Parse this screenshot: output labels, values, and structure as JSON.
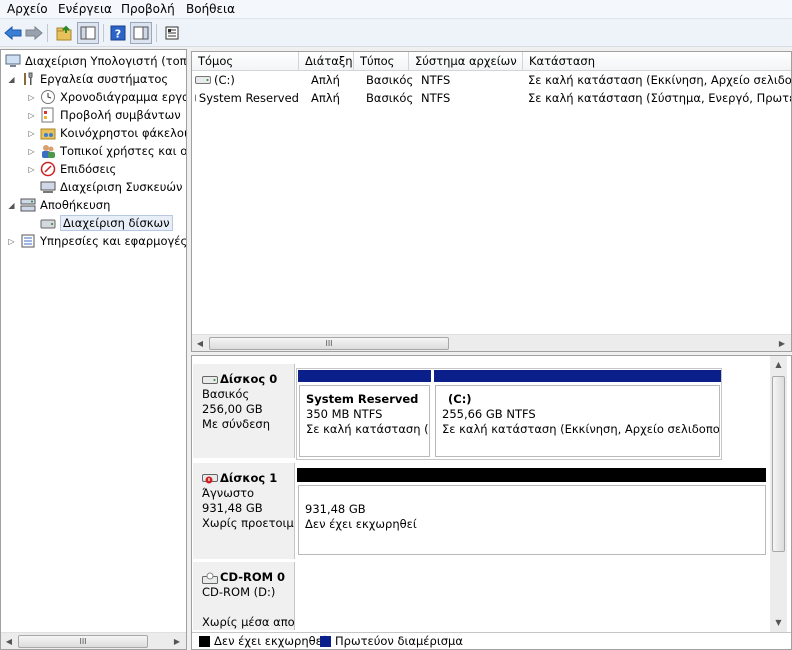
{
  "menu": [
    "Αρχείο",
    "Ενέργεια",
    "Προβολή",
    "Βοήθεια"
  ],
  "tree": {
    "root": "Διαχείριση Υπολογιστή (τοπικός)",
    "system_tools": "Εργαλεία συστήματος",
    "task_scheduler": "Χρονοδιάγραμμα εργασιών",
    "event_viewer": "Προβολή συμβάντων",
    "shared_folders": "Κοινόχρηστοι φάκελοι",
    "local_users": "Τοπικοί χρήστες και ομάδες",
    "performance": "Επιδόσεις",
    "device_manager": "Διαχείριση Συσκευών",
    "storage": "Αποθήκευση",
    "disk_management": "Διαχείριση δίσκων",
    "services": "Υπηρεσίες και εφαρμογές"
  },
  "list": {
    "headers": [
      "Τόμος",
      "Διάταξη",
      "Τύπος",
      "Σύστημα αρχείων",
      "Κατάσταση"
    ],
    "rows": [
      {
        "volume": "(C:)",
        "layout": "Απλή",
        "type": "Βασικός",
        "fs": "NTFS",
        "status": "Σε καλή κατάσταση (Εκκίνηση, Αρχείο σελιδοποίησης, Ενδεία σφαλμάτων, Πρωτεύον διαμέρισμα)"
      },
      {
        "volume": "System Reserved",
        "layout": "Απλή",
        "type": "Βασικός",
        "fs": "NTFS",
        "status": "Σε καλή κατάσταση (Σύστημα, Ενεργό, Πρωτεύον διαμέρισμα)"
      }
    ],
    "scroll_grip": "III"
  },
  "disks": {
    "disk0": {
      "name": "Δίσκος 0",
      "type": "Βασικός",
      "size": "256,00 GB",
      "state": "Με σύνδεση"
    },
    "disk0_p1": {
      "name": "System Reserved",
      "size": "350 MB NTFS",
      "status": "Σε καλή κατάσταση (Σύστημα, Ενεργό)"
    },
    "disk0_p2": {
      "name": "(C:)",
      "size": "255,66 GB NTFS",
      "status": "Σε καλή κατάσταση (Εκκίνηση, Αρχείο σελιδοποίησης)"
    },
    "disk1": {
      "name": "Δίσκος 1",
      "type": "Άγνωστο",
      "size": "931,48 GB",
      "state": "Χωρίς προετοιμασία"
    },
    "disk1_p1": {
      "size": "931,48 GB",
      "status": "Δεν έχει εκχωρηθεί"
    },
    "cdrom": {
      "name": "CD-ROM 0",
      "drive": "CD-ROM (D:)",
      "state": "Χωρίς μέσα αποθήκευσης"
    }
  },
  "legend": {
    "unallocated": "Δεν έχει εκχωρηθεί",
    "primary": "Πρωτεύον διαμέρισμα"
  },
  "colors": {
    "primary": "#0b1f8a",
    "unallocated": "#000000",
    "selection": "#e8eef8"
  }
}
